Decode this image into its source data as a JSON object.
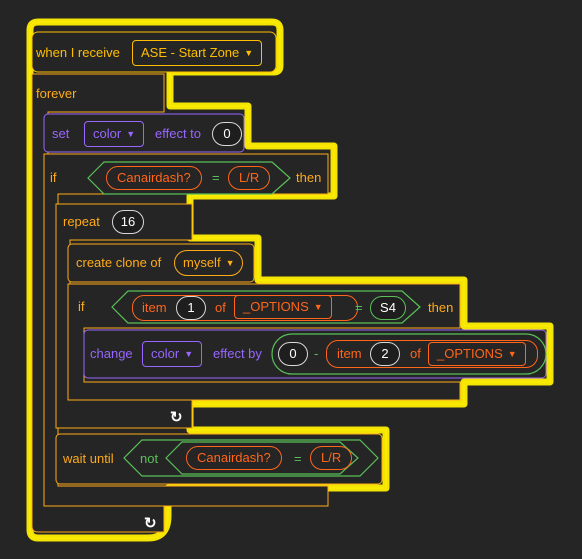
{
  "event": {
    "when_label": "when I receive",
    "message": "ASE - Start Zone"
  },
  "forever_label": "forever",
  "set_effect": {
    "set_label": "set",
    "effect_name": "color",
    "effect_to_label": "effect to",
    "value": "0"
  },
  "outer_if": {
    "if_label": "if",
    "sensing": "Canairdash?",
    "equals": "=",
    "compare_value": "L/R",
    "then_label": "then"
  },
  "repeat": {
    "label": "repeat",
    "count": "16"
  },
  "clone": {
    "label": "create clone of",
    "target": "myself"
  },
  "inner_if": {
    "if_label": "if",
    "item_label": "item",
    "index": "1",
    "of_label": "of",
    "list_name": "_OPTIONS",
    "equals": "=",
    "compare_value": "S4",
    "then_label": "then"
  },
  "change_effect": {
    "change_label": "change",
    "effect_name": "color",
    "effect_by_label": "effect by",
    "minuend": "0",
    "minus": "-",
    "item_label": "item",
    "index": "2",
    "of_label": "of",
    "list_name": "_OPTIONS"
  },
  "wait": {
    "label": "wait until",
    "not_label": "not",
    "sensing": "Canairdash?",
    "equals": "=",
    "compare_value": "L/R"
  },
  "loop_arrow_glyph": "↻",
  "colors": {
    "highlight": "#ffee00",
    "events": "#ffbf00",
    "control": "#ffab19",
    "looks": "#9966ff",
    "operators": "#59c059",
    "sensing": "#5cb1d6",
    "lists": "#ff661a",
    "block_fill": "#252525"
  }
}
